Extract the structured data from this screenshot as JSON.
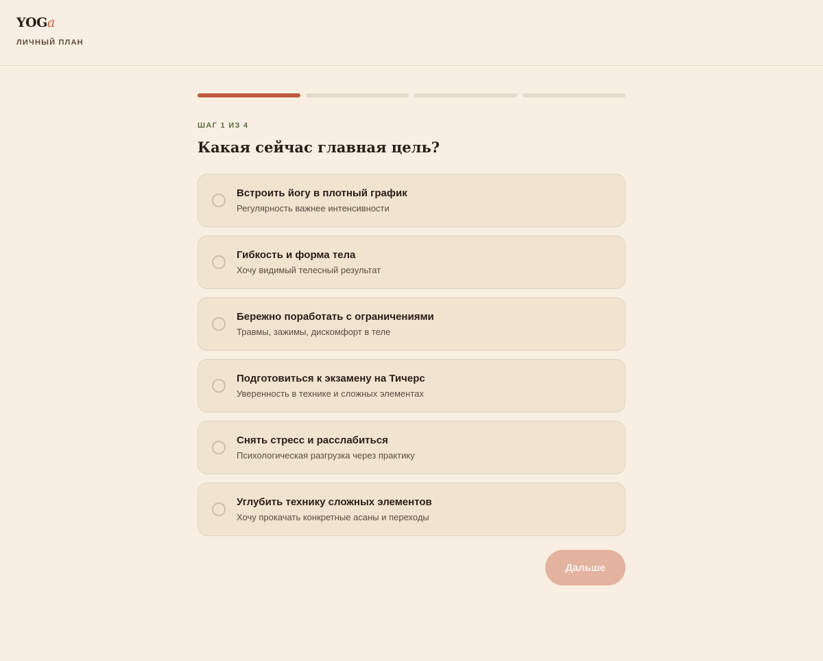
{
  "header": {
    "logo_main": "YOG",
    "logo_accent": "a",
    "subtitle": "ЛИЧНЫЙ ПЛАН"
  },
  "progress": {
    "current_step": 1,
    "total_steps": 4
  },
  "step_label": "ШАГ 1 ИЗ 4",
  "question": "Какая сейчас главная цель?",
  "options": [
    {
      "title": "Встроить йогу в плотный график",
      "description": "Регулярность важнее интенсивности"
    },
    {
      "title": "Гибкость и форма тела",
      "description": "Хочу видимый телесный результат"
    },
    {
      "title": "Бережно поработать с ограничениями",
      "description": "Травмы, зажимы, дискомфорт в теле"
    },
    {
      "title": "Подготовиться к экзамену на Тичерс",
      "description": "Уверенность в технике и сложных элементах"
    },
    {
      "title": "Снять стресс и расслабиться",
      "description": "Психологическая разгрузка через практику"
    },
    {
      "title": "Углубить технику сложных элементов",
      "description": "Хочу прокачать конкретные асаны и переходы"
    }
  ],
  "next_button": {
    "label": "Дальше",
    "enabled": false
  },
  "colors": {
    "background": "#f8efe2",
    "accent": "#bc5a3e",
    "step_label": "#5e6b45",
    "option_bg": "#f0e3d0",
    "button_disabled": "#e3b3a0"
  }
}
